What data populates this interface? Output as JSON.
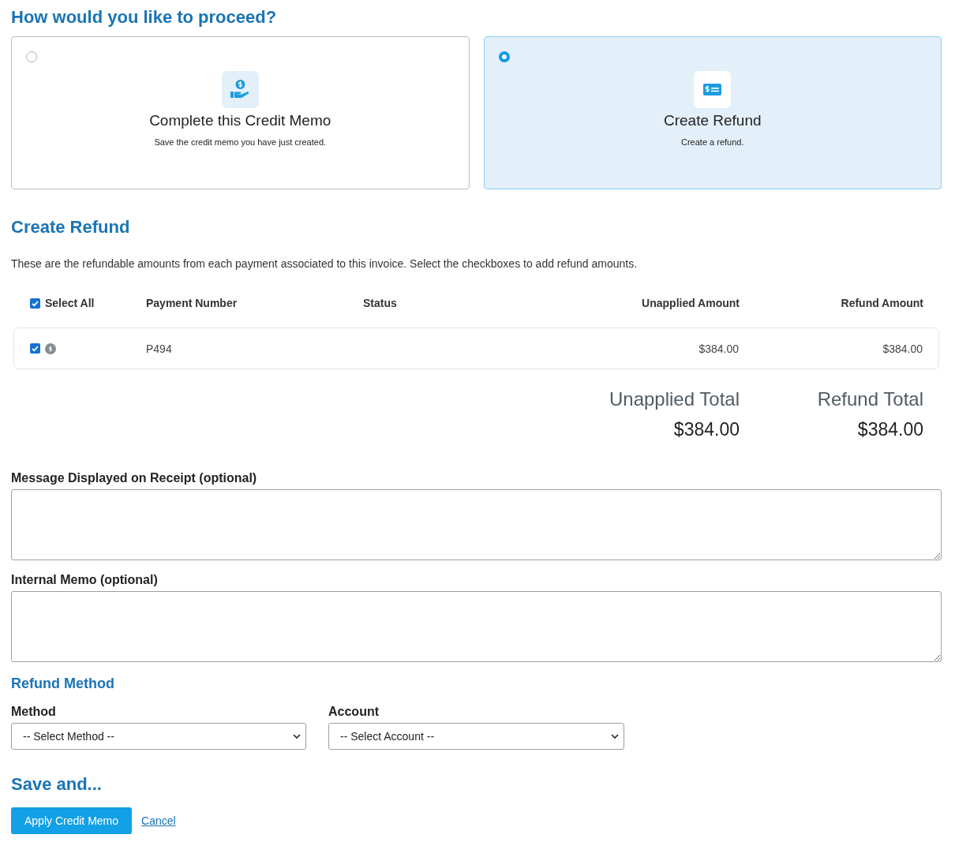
{
  "proceed": {
    "title": "How would you like to proceed?",
    "options": [
      {
        "kind": "memo",
        "title": "Complete this Credit Memo",
        "description": "Save the credit memo you have just created.",
        "selected": false
      },
      {
        "kind": "refund",
        "title": "Create Refund",
        "description": "Create a refund.",
        "selected": true
      }
    ]
  },
  "refund": {
    "title": "Create Refund",
    "intro": "These are the refundable amounts from each payment associated to this invoice. Select the checkboxes to add refund amounts.",
    "table": {
      "select_all": {
        "label": "Select All",
        "checked": true
      },
      "columns": [
        "Payment Number",
        "Status",
        "Unapplied Amount",
        "Refund Amount"
      ],
      "rows": [
        {
          "checked": true,
          "payment_number": "P494",
          "unapplied_amount": "$384.00",
          "refund_amount": "$384.00"
        }
      ]
    },
    "totals": [
      {
        "label": "Unapplied Total",
        "value": "$384.00"
      },
      {
        "label": "Refund Total",
        "value": "$384.00"
      }
    ]
  },
  "notes": [
    {
      "label": "Message Displayed on Receipt (optional)"
    },
    {
      "label": "Internal Memo (optional)"
    }
  ],
  "refund_method": {
    "title": "Refund Method",
    "fields": [
      {
        "label": "Method",
        "value": "-- Select Method --"
      },
      {
        "label": "Account",
        "value": "-- Select Account --"
      }
    ]
  },
  "save": {
    "title": "Save and...",
    "buttons": [
      {
        "kind": "primary",
        "label": "Apply Credit Memo"
      },
      {
        "kind": "link",
        "label": "Cancel"
      }
    ]
  }
}
